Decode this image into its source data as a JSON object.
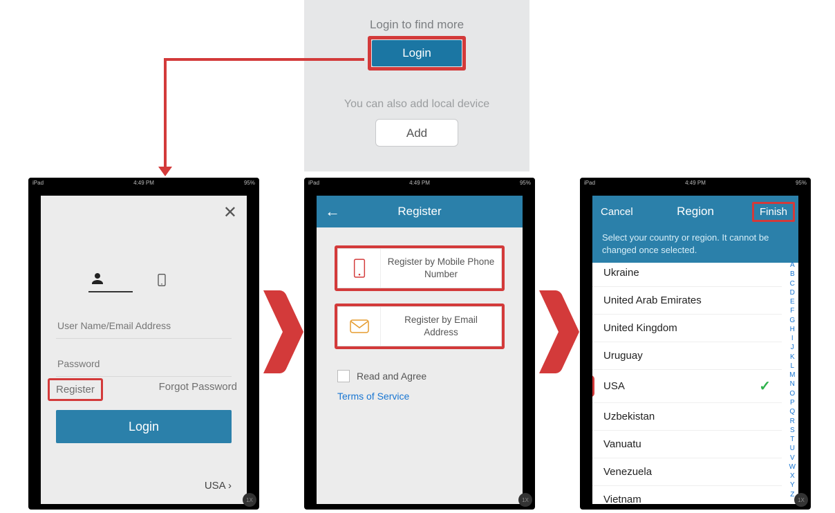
{
  "welcome": {
    "prompt1": "Login to find more",
    "login_label": "Login",
    "prompt2": "You can also add local device",
    "add_label": "Add"
  },
  "status": {
    "carrier": "iPad",
    "time": "4:49 PM",
    "battery": "95%"
  },
  "phone1": {
    "user_ph": "User Name/Email Address",
    "pass_ph": "Password",
    "register": "Register",
    "forgot": "Forgot Password",
    "login_label": "Login",
    "country": "USA"
  },
  "phone2": {
    "title": "Register",
    "opt_mobile": "Register by Mobile Phone Number",
    "opt_email": "Register by Email Address",
    "agree": "Read and Agree",
    "tos": "Terms of Service"
  },
  "phone3": {
    "cancel": "Cancel",
    "title": "Region",
    "finish": "Finish",
    "note": "Select your country or region. It cannot be changed once selected.",
    "countries": {
      "c0": "Ukraine",
      "c1": "United Arab Emirates",
      "c2": "United Kingdom",
      "c3": "Uruguay",
      "c4": "USA",
      "c5": "Uzbekistan",
      "c6": "Vanuatu",
      "c7": "Venezuela",
      "c8": "Vietnam"
    },
    "alpha": [
      "A",
      "B",
      "C",
      "D",
      "E",
      "F",
      "G",
      "H",
      "I",
      "J",
      "K",
      "L",
      "M",
      "N",
      "O",
      "P",
      "Q",
      "R",
      "S",
      "T",
      "U",
      "V",
      "W",
      "X",
      "Y",
      "Z"
    ]
  },
  "fab": "1X"
}
